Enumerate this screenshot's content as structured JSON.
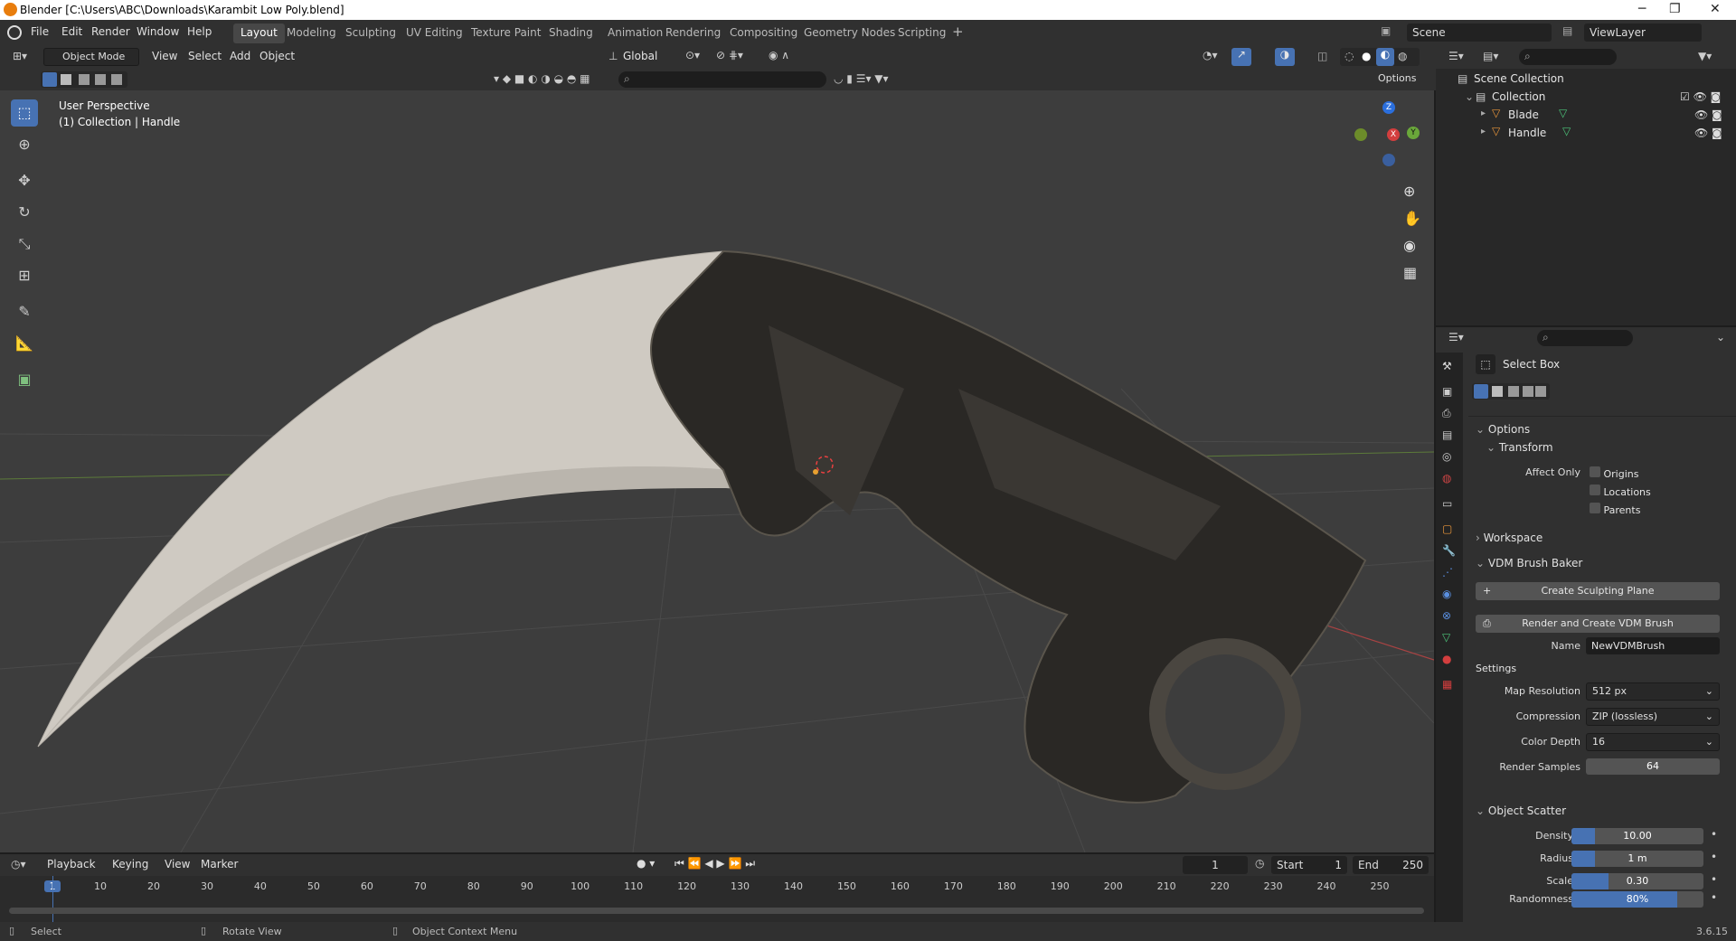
{
  "window": {
    "title": "Blender [C:\\Users\\ABC\\Downloads\\Karambit Low Poly.blend]",
    "minimize": "─",
    "restore": "❐",
    "close": "✕"
  },
  "menu": [
    "File",
    "Edit",
    "Render",
    "Window",
    "Help"
  ],
  "workspaces": [
    "Layout",
    "Modeling",
    "Sculpting",
    "UV Editing",
    "Texture Paint",
    "Shading",
    "Animation",
    "Rendering",
    "Compositing",
    "Geometry Nodes",
    "Scripting"
  ],
  "add_workspace": "+",
  "scene": {
    "label": "Scene",
    "view_layer": "ViewLayer"
  },
  "viewport_header": {
    "mode": "Object Mode",
    "menus": [
      "View",
      "Select",
      "Add",
      "Object"
    ],
    "orientation": "Global",
    "options": "Options"
  },
  "overlay_text": {
    "perspective": "User Perspective",
    "collection": "(1) Collection | Handle"
  },
  "gizmo": {
    "z": "Z",
    "y": "Y",
    "x": "X"
  },
  "outliner": {
    "root": "Scene Collection",
    "collection": "Collection",
    "items": [
      "Blade",
      "Handle"
    ]
  },
  "properties": {
    "tool": "Select Box",
    "options": "Options",
    "transform": "Transform",
    "affect_only": "Affect Only",
    "affect_items": [
      "Origins",
      "Locations",
      "Parents"
    ],
    "workspace": "Workspace",
    "vdm": {
      "title": "VDM Brush Baker",
      "create_plane": "Create Sculpting Plane",
      "render_create": "Render and Create VDM Brush",
      "name_label": "Name",
      "name_value": "NewVDMBrush",
      "settings": "Settings",
      "rows": [
        {
          "label": "Map Resolution",
          "value": "512 px"
        },
        {
          "label": "Compression",
          "value": "ZIP (lossless)"
        },
        {
          "label": "Color Depth",
          "value": "16"
        }
      ],
      "render_samples_label": "Render Samples",
      "render_samples": "64"
    },
    "scatter": {
      "title": "Object Scatter",
      "rows": [
        {
          "label": "Density",
          "value": "10.00",
          "fill": 0.18
        },
        {
          "label": "Radius",
          "value": "1 m",
          "fill": 0.18
        },
        {
          "label": "Scale",
          "value": "0.30",
          "fill": 0.28
        },
        {
          "label": "Randomness",
          "value": "80%",
          "fill": 0.8
        }
      ]
    }
  },
  "timeline": {
    "menus": [
      "Playback",
      "Keying",
      "View",
      "Marker"
    ],
    "current_frame": "1",
    "start_label": "Start",
    "start": "1",
    "end_label": "End",
    "end": "250",
    "ticks": [
      "1",
      "10",
      "20",
      "30",
      "40",
      "50",
      "60",
      "70",
      "80",
      "90",
      "100",
      "110",
      "120",
      "130",
      "140",
      "150",
      "160",
      "170",
      "180",
      "190",
      "200",
      "210",
      "220",
      "230",
      "240",
      "250"
    ]
  },
  "statusbar": {
    "select": "Select",
    "rotate": "Rotate View",
    "context": "Object Context Menu",
    "version": "3.6.15"
  }
}
